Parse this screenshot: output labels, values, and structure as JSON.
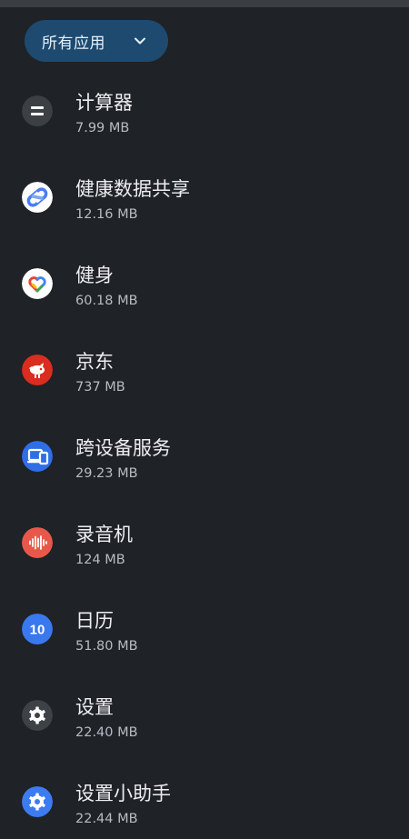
{
  "filter": {
    "label": "所有应用",
    "icon": "chevron-down-icon",
    "bg_color": "#1e4a70"
  },
  "apps": [
    {
      "name": "计算器",
      "size": "7.99 MB",
      "icon": "calculator-icon"
    },
    {
      "name": "健康数据共享",
      "size": "12.16 MB",
      "icon": "health-connect-icon"
    },
    {
      "name": "健身",
      "size": "60.18 MB",
      "icon": "google-fit-icon"
    },
    {
      "name": "京东",
      "size": "737 MB",
      "icon": "jd-icon"
    },
    {
      "name": "跨设备服务",
      "size": "29.23 MB",
      "icon": "cross-device-icon"
    },
    {
      "name": "录音机",
      "size": "124 MB",
      "icon": "recorder-icon"
    },
    {
      "name": "日历",
      "size": "51.80 MB",
      "icon": "calendar-icon",
      "icon_text": "10"
    },
    {
      "name": "设置",
      "size": "22.40 MB",
      "icon": "settings-gear-icon"
    },
    {
      "name": "设置小助手",
      "size": "22.44 MB",
      "icon": "settings-helper-icon"
    }
  ],
  "colors": {
    "background": "#1f2226",
    "primary_text": "#eceef1",
    "secondary_text": "#b8bcc2",
    "calculator": "#3c3f43",
    "jd_red": "#d92d20",
    "cross_device_blue": "#2f6ee6",
    "recorder_red": "#e8584a",
    "calendar_blue": "#3a78f0",
    "settings_gray": "#3e4145",
    "helper_blue": "#3c7cf0"
  }
}
